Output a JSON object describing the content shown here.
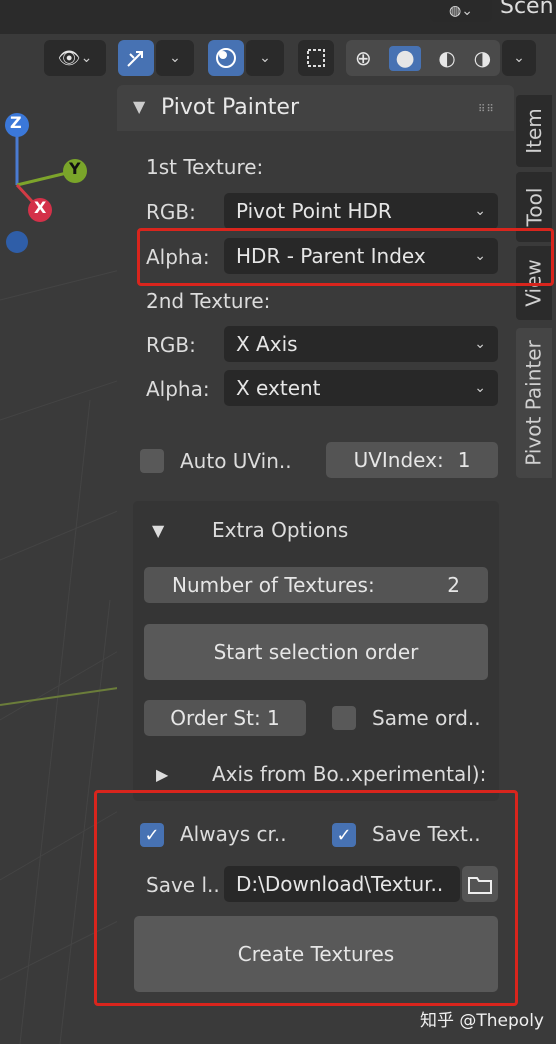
{
  "header": {
    "scene_label": "Scen"
  },
  "gizmo": {
    "z": "Z",
    "y": "Y",
    "x": "X"
  },
  "tabs": [
    {
      "label": "Item"
    },
    {
      "label": "Tool"
    },
    {
      "label": "View"
    },
    {
      "label": "Pivot Painter"
    }
  ],
  "panel": {
    "title": "Pivot Painter",
    "first_texture_label": "1st Texture:",
    "rgb_label": "RGB:",
    "alpha_label": "Alpha:",
    "tex1_rgb": "Pivot Point HDR",
    "tex1_alpha": "HDR - Parent Index",
    "second_texture_label": "2nd Texture:",
    "tex2_rgb": "X Axis",
    "tex2_alpha": "X extent",
    "auto_uv_label": "Auto UVin..",
    "uv_index_label": "UVIndex:",
    "uv_index_value": "1",
    "extra_options": {
      "title": "Extra Options",
      "num_textures_label": "Number of Textures:",
      "num_textures_value": "2",
      "start_selection": "Start selection order",
      "order_st": "Order St: 1",
      "same_ord": "Same ord..",
      "axis_from_bo": "Axis from Bo..xperimental):"
    },
    "always_cr_label": "Always cr..",
    "save_text_label": "Save Text..",
    "save_path_label": "Save l..",
    "save_path_value": "D:\\Download\\Textur..",
    "create_textures": "Create Textures"
  },
  "watermark": "知乎 @Thepoly"
}
